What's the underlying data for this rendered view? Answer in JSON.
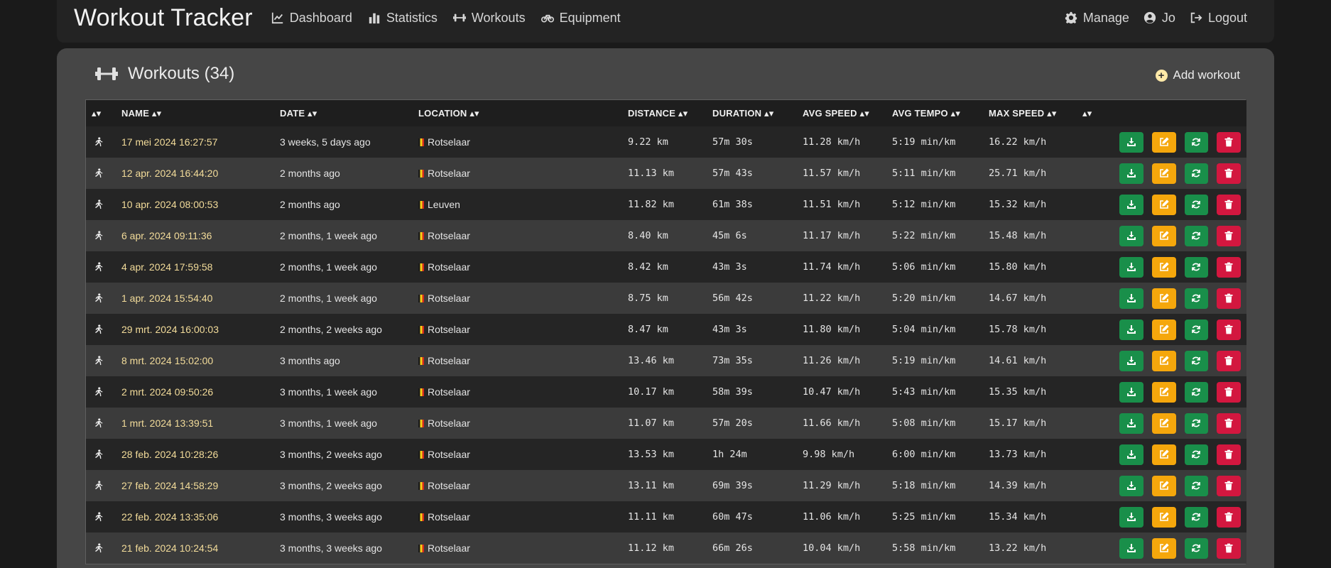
{
  "navbar": {
    "brand": "Workout Tracker",
    "left_links": [
      {
        "label": "Dashboard",
        "icon": "chart-line-icon"
      },
      {
        "label": "Statistics",
        "icon": "bar-chart-icon"
      },
      {
        "label": "Workouts",
        "icon": "dumbbell-icon"
      },
      {
        "label": "Equipment",
        "icon": "bicycle-icon"
      }
    ],
    "right_links": [
      {
        "label": "Manage",
        "icon": "gear-icon"
      },
      {
        "label": "Jo",
        "icon": "user-circle-icon"
      },
      {
        "label": "Logout",
        "icon": "logout-icon"
      }
    ]
  },
  "panel": {
    "title": "Workouts (34)",
    "add_label": "Add workout"
  },
  "table": {
    "headers": [
      "▴▾",
      "NAME ▴▾",
      "DATE ▴▾",
      "LOCATION ▴▾",
      "DISTANCE ▴▾",
      "DURATION ▴▾",
      "AVG SPEED ▴▾",
      "AVG TEMPO ▴▾",
      "MAX SPEED ▴▾",
      "▴▾",
      ""
    ],
    "rows": [
      {
        "name": "17 mei 2024 16:27:57",
        "date": "3 weeks, 5 days ago",
        "location": "Rotselaar",
        "distance": "9.22 km",
        "duration": "57m 30s",
        "avg_speed": "11.28 km/h",
        "avg_tempo": "5:19 min/km",
        "max_speed": "16.22 km/h"
      },
      {
        "name": "12 apr. 2024 16:44:20",
        "date": "2 months ago",
        "location": "Rotselaar",
        "distance": "11.13 km",
        "duration": "57m 43s",
        "avg_speed": "11.57 km/h",
        "avg_tempo": "5:11 min/km",
        "max_speed": "25.71 km/h"
      },
      {
        "name": "10 apr. 2024 08:00:53",
        "date": "2 months ago",
        "location": "Leuven",
        "distance": "11.82 km",
        "duration": "61m 38s",
        "avg_speed": "11.51 km/h",
        "avg_tempo": "5:12 min/km",
        "max_speed": "15.32 km/h"
      },
      {
        "name": "6 apr. 2024 09:11:36",
        "date": "2 months, 1 week ago",
        "location": "Rotselaar",
        "distance": "8.40 km",
        "duration": "45m 6s",
        "avg_speed": "11.17 km/h",
        "avg_tempo": "5:22 min/km",
        "max_speed": "15.48 km/h"
      },
      {
        "name": "4 apr. 2024 17:59:58",
        "date": "2 months, 1 week ago",
        "location": "Rotselaar",
        "distance": "8.42 km",
        "duration": "43m 3s",
        "avg_speed": "11.74 km/h",
        "avg_tempo": "5:06 min/km",
        "max_speed": "15.80 km/h"
      },
      {
        "name": "1 apr. 2024 15:54:40",
        "date": "2 months, 1 week ago",
        "location": "Rotselaar",
        "distance": "8.75 km",
        "duration": "56m 42s",
        "avg_speed": "11.22 km/h",
        "avg_tempo": "5:20 min/km",
        "max_speed": "14.67 km/h"
      },
      {
        "name": "29 mrt. 2024 16:00:03",
        "date": "2 months, 2 weeks ago",
        "location": "Rotselaar",
        "distance": "8.47 km",
        "duration": "43m 3s",
        "avg_speed": "11.80 km/h",
        "avg_tempo": "5:04 min/km",
        "max_speed": "15.78 km/h"
      },
      {
        "name": "8 mrt. 2024 15:02:00",
        "date": "3 months ago",
        "location": "Rotselaar",
        "distance": "13.46 km",
        "duration": "73m 35s",
        "avg_speed": "11.26 km/h",
        "avg_tempo": "5:19 min/km",
        "max_speed": "14.61 km/h"
      },
      {
        "name": "2 mrt. 2024 09:50:26",
        "date": "3 months, 1 week ago",
        "location": "Rotselaar",
        "distance": "10.17 km",
        "duration": "58m 39s",
        "avg_speed": "10.47 km/h",
        "avg_tempo": "5:43 min/km",
        "max_speed": "15.35 km/h"
      },
      {
        "name": "1 mrt. 2024 13:39:51",
        "date": "3 months, 1 week ago",
        "location": "Rotselaar",
        "distance": "11.07 km",
        "duration": "57m 20s",
        "avg_speed": "11.66 km/h",
        "avg_tempo": "5:08 min/km",
        "max_speed": "15.17 km/h"
      },
      {
        "name": "28 feb. 2024 10:28:26",
        "date": "3 months, 2 weeks ago",
        "location": "Rotselaar",
        "distance": "13.53 km",
        "duration": "1h 24m",
        "avg_speed": "9.98 km/h",
        "avg_tempo": "6:00 min/km",
        "max_speed": "13.73 km/h"
      },
      {
        "name": "27 feb. 2024 14:58:29",
        "date": "3 months, 2 weeks ago",
        "location": "Rotselaar",
        "distance": "13.11 km",
        "duration": "69m 39s",
        "avg_speed": "11.29 km/h",
        "avg_tempo": "5:18 min/km",
        "max_speed": "14.39 km/h"
      },
      {
        "name": "22 feb. 2024 13:35:06",
        "date": "3 months, 3 weeks ago",
        "location": "Rotselaar",
        "distance": "11.11 km",
        "duration": "60m 47s",
        "avg_speed": "11.06 km/h",
        "avg_tempo": "5:25 min/km",
        "max_speed": "15.34 km/h"
      },
      {
        "name": "21 feb. 2024 10:24:54",
        "date": "3 months, 3 weeks ago",
        "location": "Rotselaar",
        "distance": "11.12 km",
        "duration": "66m 26s",
        "avg_speed": "10.04 km/h",
        "avg_tempo": "5:58 min/km",
        "max_speed": "13.22 km/h"
      }
    ],
    "row_icon": "running-icon",
    "actions": [
      {
        "name": "download-button",
        "icon": "download-icon",
        "color": "#198f4a"
      },
      {
        "name": "edit-button",
        "icon": "edit-icon",
        "color": "#f5a70c"
      },
      {
        "name": "refresh-button",
        "icon": "refresh-icon",
        "color": "#198f4a"
      },
      {
        "name": "delete-button",
        "icon": "trash-icon",
        "color": "#d3173f"
      }
    ]
  },
  "colors": {
    "background": "#1a1a1a",
    "navbar": "#232323",
    "panel": "#464646",
    "name_link": "#f3dc9a",
    "green": "#198f4a",
    "orange": "#f5a70c",
    "red": "#d3173f"
  }
}
